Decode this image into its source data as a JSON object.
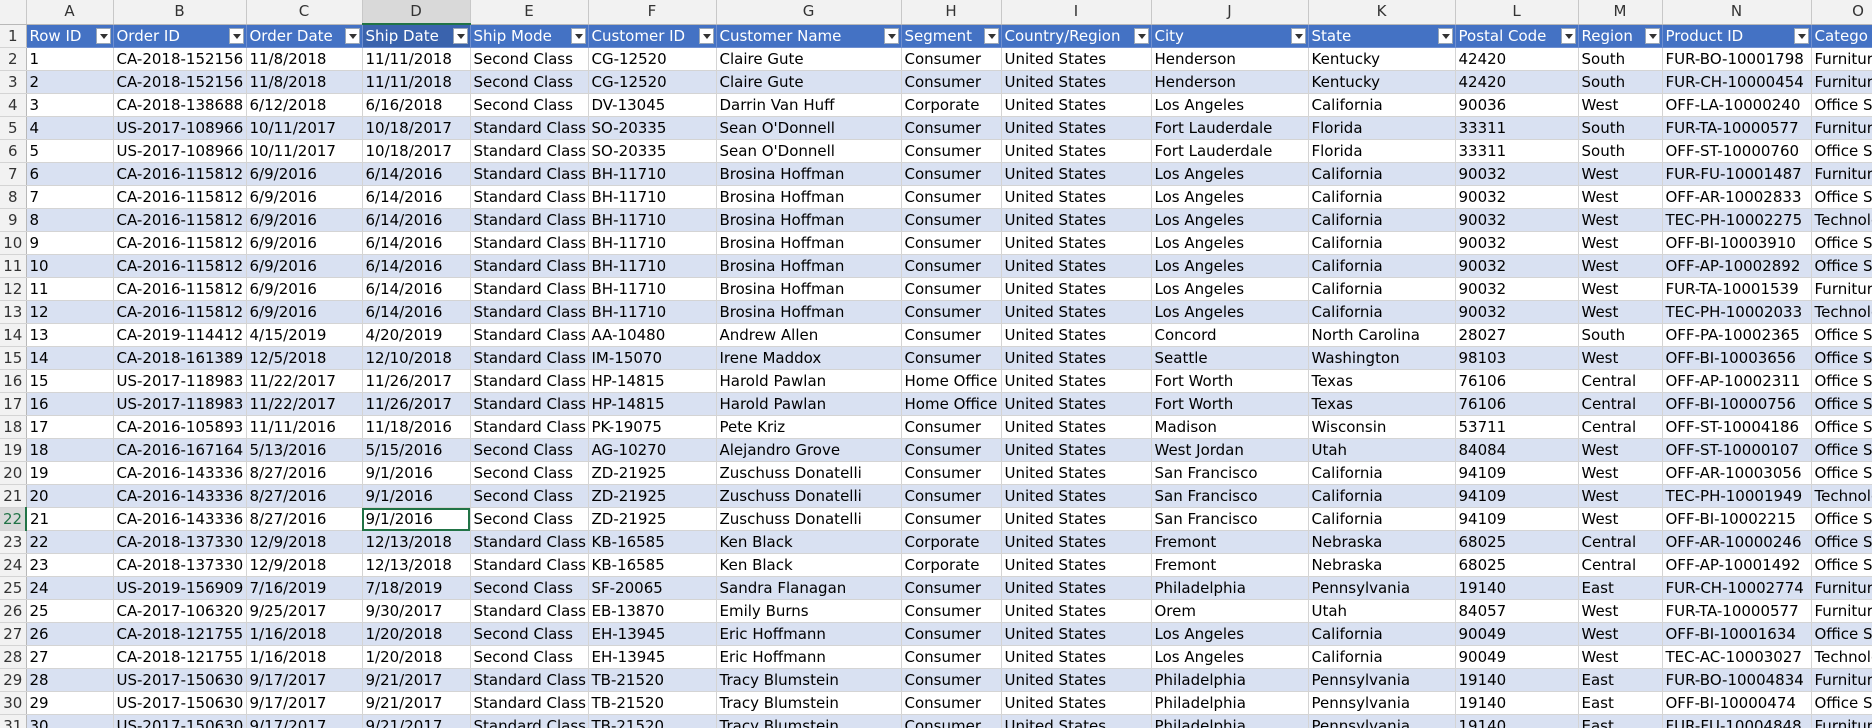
{
  "column_letters": [
    "A",
    "B",
    "C",
    "D",
    "E",
    "F",
    "G",
    "H",
    "I",
    "J",
    "K",
    "L",
    "M",
    "N",
    "O"
  ],
  "selected_column": "D",
  "header_fields": [
    "Row ID",
    "Order ID",
    "Order Date",
    "Ship Date",
    "Ship Mode",
    "Customer ID",
    "Customer Name",
    "Segment",
    "Country/Region",
    "City",
    "State",
    "Postal Code",
    "Region",
    "Product ID",
    "Catego"
  ],
  "active_cell": {
    "row": 22,
    "column": "D",
    "value": "9/1/2016"
  },
  "rows": [
    {
      "num": "2",
      "cells": [
        "1",
        "CA-2018-152156",
        "11/8/2018",
        "11/11/2018",
        "Second Class",
        "CG-12520",
        "Claire Gute",
        "Consumer",
        "United States",
        "Henderson",
        "Kentucky",
        "42420",
        "South",
        "FUR-BO-10001798",
        "Furnitur"
      ]
    },
    {
      "num": "3",
      "cells": [
        "2",
        "CA-2018-152156",
        "11/8/2018",
        "11/11/2018",
        "Second Class",
        "CG-12520",
        "Claire Gute",
        "Consumer",
        "United States",
        "Henderson",
        "Kentucky",
        "42420",
        "South",
        "FUR-CH-10000454",
        "Furnitur"
      ]
    },
    {
      "num": "4",
      "cells": [
        "3",
        "CA-2018-138688",
        "6/12/2018",
        "6/16/2018",
        "Second Class",
        "DV-13045",
        "Darrin Van Huff",
        "Corporate",
        "United States",
        "Los Angeles",
        "California",
        "90036",
        "West",
        "OFF-LA-10000240",
        "Office Su"
      ]
    },
    {
      "num": "5",
      "cells": [
        "4",
        "US-2017-108966",
        "10/11/2017",
        "10/18/2017",
        "Standard Class",
        "SO-20335",
        "Sean O'Donnell",
        "Consumer",
        "United States",
        "Fort Lauderdale",
        "Florida",
        "33311",
        "South",
        "FUR-TA-10000577",
        "Furnitur"
      ]
    },
    {
      "num": "6",
      "cells": [
        "5",
        "US-2017-108966",
        "10/11/2017",
        "10/18/2017",
        "Standard Class",
        "SO-20335",
        "Sean O'Donnell",
        "Consumer",
        "United States",
        "Fort Lauderdale",
        "Florida",
        "33311",
        "South",
        "OFF-ST-10000760",
        "Office Su"
      ]
    },
    {
      "num": "7",
      "cells": [
        "6",
        "CA-2016-115812",
        "6/9/2016",
        "6/14/2016",
        "Standard Class",
        "BH-11710",
        "Brosina Hoffman",
        "Consumer",
        "United States",
        "Los Angeles",
        "California",
        "90032",
        "West",
        "FUR-FU-10001487",
        "Furnitur"
      ]
    },
    {
      "num": "8",
      "cells": [
        "7",
        "CA-2016-115812",
        "6/9/2016",
        "6/14/2016",
        "Standard Class",
        "BH-11710",
        "Brosina Hoffman",
        "Consumer",
        "United States",
        "Los Angeles",
        "California",
        "90032",
        "West",
        "OFF-AR-10002833",
        "Office Su"
      ]
    },
    {
      "num": "9",
      "cells": [
        "8",
        "CA-2016-115812",
        "6/9/2016",
        "6/14/2016",
        "Standard Class",
        "BH-11710",
        "Brosina Hoffman",
        "Consumer",
        "United States",
        "Los Angeles",
        "California",
        "90032",
        "West",
        "TEC-PH-10002275",
        "Technolo"
      ]
    },
    {
      "num": "10",
      "cells": [
        "9",
        "CA-2016-115812",
        "6/9/2016",
        "6/14/2016",
        "Standard Class",
        "BH-11710",
        "Brosina Hoffman",
        "Consumer",
        "United States",
        "Los Angeles",
        "California",
        "90032",
        "West",
        "OFF-BI-10003910",
        "Office Su"
      ]
    },
    {
      "num": "11",
      "cells": [
        "10",
        "CA-2016-115812",
        "6/9/2016",
        "6/14/2016",
        "Standard Class",
        "BH-11710",
        "Brosina Hoffman",
        "Consumer",
        "United States",
        "Los Angeles",
        "California",
        "90032",
        "West",
        "OFF-AP-10002892",
        "Office Su"
      ]
    },
    {
      "num": "12",
      "cells": [
        "11",
        "CA-2016-115812",
        "6/9/2016",
        "6/14/2016",
        "Standard Class",
        "BH-11710",
        "Brosina Hoffman",
        "Consumer",
        "United States",
        "Los Angeles",
        "California",
        "90032",
        "West",
        "FUR-TA-10001539",
        "Furnitur"
      ]
    },
    {
      "num": "13",
      "cells": [
        "12",
        "CA-2016-115812",
        "6/9/2016",
        "6/14/2016",
        "Standard Class",
        "BH-11710",
        "Brosina Hoffman",
        "Consumer",
        "United States",
        "Los Angeles",
        "California",
        "90032",
        "West",
        "TEC-PH-10002033",
        "Technolo"
      ]
    },
    {
      "num": "14",
      "cells": [
        "13",
        "CA-2019-114412",
        "4/15/2019",
        "4/20/2019",
        "Standard Class",
        "AA-10480",
        "Andrew Allen",
        "Consumer",
        "United States",
        "Concord",
        "North Carolina",
        "28027",
        "South",
        "OFF-PA-10002365",
        "Office Su"
      ]
    },
    {
      "num": "15",
      "cells": [
        "14",
        "CA-2018-161389",
        "12/5/2018",
        "12/10/2018",
        "Standard Class",
        "IM-15070",
        "Irene Maddox",
        "Consumer",
        "United States",
        "Seattle",
        "Washington",
        "98103",
        "West",
        "OFF-BI-10003656",
        "Office Su"
      ]
    },
    {
      "num": "16",
      "cells": [
        "15",
        "US-2017-118983",
        "11/22/2017",
        "11/26/2017",
        "Standard Class",
        "HP-14815",
        "Harold Pawlan",
        "Home Office",
        "United States",
        "Fort Worth",
        "Texas",
        "76106",
        "Central",
        "OFF-AP-10002311",
        "Office Su"
      ]
    },
    {
      "num": "17",
      "cells": [
        "16",
        "US-2017-118983",
        "11/22/2017",
        "11/26/2017",
        "Standard Class",
        "HP-14815",
        "Harold Pawlan",
        "Home Office",
        "United States",
        "Fort Worth",
        "Texas",
        "76106",
        "Central",
        "OFF-BI-10000756",
        "Office Su"
      ]
    },
    {
      "num": "18",
      "cells": [
        "17",
        "CA-2016-105893",
        "11/11/2016",
        "11/18/2016",
        "Standard Class",
        "PK-19075",
        "Pete Kriz",
        "Consumer",
        "United States",
        "Madison",
        "Wisconsin",
        "53711",
        "Central",
        "OFF-ST-10004186",
        "Office Su"
      ]
    },
    {
      "num": "19",
      "cells": [
        "18",
        "CA-2016-167164",
        "5/13/2016",
        "5/15/2016",
        "Second Class",
        "AG-10270",
        "Alejandro Grove",
        "Consumer",
        "United States",
        "West Jordan",
        "Utah",
        "84084",
        "West",
        "OFF-ST-10000107",
        "Office Su"
      ]
    },
    {
      "num": "20",
      "cells": [
        "19",
        "CA-2016-143336",
        "8/27/2016",
        "9/1/2016",
        "Second Class",
        "ZD-21925",
        "Zuschuss Donatelli",
        "Consumer",
        "United States",
        "San Francisco",
        "California",
        "94109",
        "West",
        "OFF-AR-10003056",
        "Office Su"
      ]
    },
    {
      "num": "21",
      "cells": [
        "20",
        "CA-2016-143336",
        "8/27/2016",
        "9/1/2016",
        "Second Class",
        "ZD-21925",
        "Zuschuss Donatelli",
        "Consumer",
        "United States",
        "San Francisco",
        "California",
        "94109",
        "West",
        "TEC-PH-10001949",
        "Technolo"
      ]
    },
    {
      "num": "22",
      "cells": [
        "21",
        "CA-2016-143336",
        "8/27/2016",
        "9/1/2016",
        "Second Class",
        "ZD-21925",
        "Zuschuss Donatelli",
        "Consumer",
        "United States",
        "San Francisco",
        "California",
        "94109",
        "West",
        "OFF-BI-10002215",
        "Office Su"
      ]
    },
    {
      "num": "23",
      "cells": [
        "22",
        "CA-2018-137330",
        "12/9/2018",
        "12/13/2018",
        "Standard Class",
        "KB-16585",
        "Ken Black",
        "Corporate",
        "United States",
        "Fremont",
        "Nebraska",
        "68025",
        "Central",
        "OFF-AR-10000246",
        "Office Su"
      ]
    },
    {
      "num": "24",
      "cells": [
        "23",
        "CA-2018-137330",
        "12/9/2018",
        "12/13/2018",
        "Standard Class",
        "KB-16585",
        "Ken Black",
        "Corporate",
        "United States",
        "Fremont",
        "Nebraska",
        "68025",
        "Central",
        "OFF-AP-10001492",
        "Office Su"
      ]
    },
    {
      "num": "25",
      "cells": [
        "24",
        "US-2019-156909",
        "7/16/2019",
        "7/18/2019",
        "Second Class",
        "SF-20065",
        "Sandra Flanagan",
        "Consumer",
        "United States",
        "Philadelphia",
        "Pennsylvania",
        "19140",
        "East",
        "FUR-CH-10002774",
        "Furnitur"
      ]
    },
    {
      "num": "26",
      "cells": [
        "25",
        "CA-2017-106320",
        "9/25/2017",
        "9/30/2017",
        "Standard Class",
        "EB-13870",
        "Emily Burns",
        "Consumer",
        "United States",
        "Orem",
        "Utah",
        "84057",
        "West",
        "FUR-TA-10000577",
        "Furnitur"
      ]
    },
    {
      "num": "27",
      "cells": [
        "26",
        "CA-2018-121755",
        "1/16/2018",
        "1/20/2018",
        "Second Class",
        "EH-13945",
        "Eric Hoffmann",
        "Consumer",
        "United States",
        "Los Angeles",
        "California",
        "90049",
        "West",
        "OFF-BI-10001634",
        "Office Su"
      ]
    },
    {
      "num": "28",
      "cells": [
        "27",
        "CA-2018-121755",
        "1/16/2018",
        "1/20/2018",
        "Second Class",
        "EH-13945",
        "Eric Hoffmann",
        "Consumer",
        "United States",
        "Los Angeles",
        "California",
        "90049",
        "West",
        "TEC-AC-10003027",
        "Technolo"
      ]
    },
    {
      "num": "29",
      "cells": [
        "28",
        "US-2017-150630",
        "9/17/2017",
        "9/21/2017",
        "Standard Class",
        "TB-21520",
        "Tracy Blumstein",
        "Consumer",
        "United States",
        "Philadelphia",
        "Pennsylvania",
        "19140",
        "East",
        "FUR-BO-10004834",
        "Furnitur"
      ]
    },
    {
      "num": "30",
      "cells": [
        "29",
        "US-2017-150630",
        "9/17/2017",
        "9/21/2017",
        "Standard Class",
        "TB-21520",
        "Tracy Blumstein",
        "Consumer",
        "United States",
        "Philadelphia",
        "Pennsylvania",
        "19140",
        "East",
        "OFF-BI-10000474",
        "Office Su"
      ]
    },
    {
      "num": "31",
      "cells": [
        "30",
        "US-2017-150630",
        "9/17/2017",
        "9/21/2017",
        "Standard Class",
        "TB-21520",
        "Tracy Blumstein",
        "Consumer",
        "United States",
        "Philadelphia",
        "Pennsylvania",
        "19140",
        "East",
        "FUR-FU-10004848",
        "Furnitur"
      ]
    }
  ]
}
